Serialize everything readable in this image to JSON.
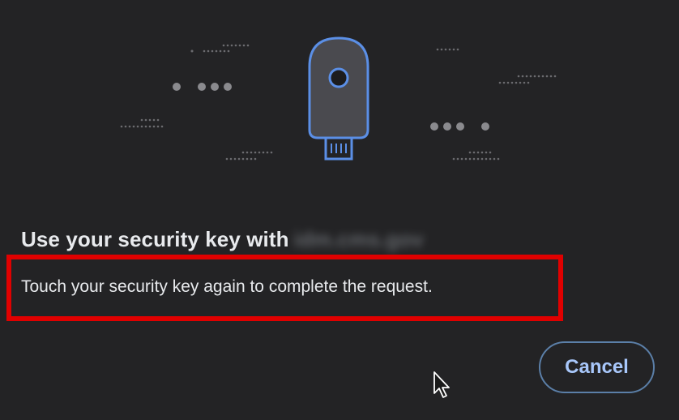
{
  "dialog": {
    "title": "Use your security key with",
    "domain": "idm.cms.gov",
    "instruction": "Touch your security key again to complete the request.",
    "cancel_label": "Cancel"
  },
  "icons": {
    "illustration": "security-key-icon",
    "cursor": "mouse-pointer-icon"
  },
  "colors": {
    "background": "#232325",
    "key_outline": "#5b8fe6",
    "key_body": "#4a4a4f",
    "highlight_box": "#e00000",
    "button_text": "#a8c7fa",
    "button_border": "#5b7fa8"
  }
}
